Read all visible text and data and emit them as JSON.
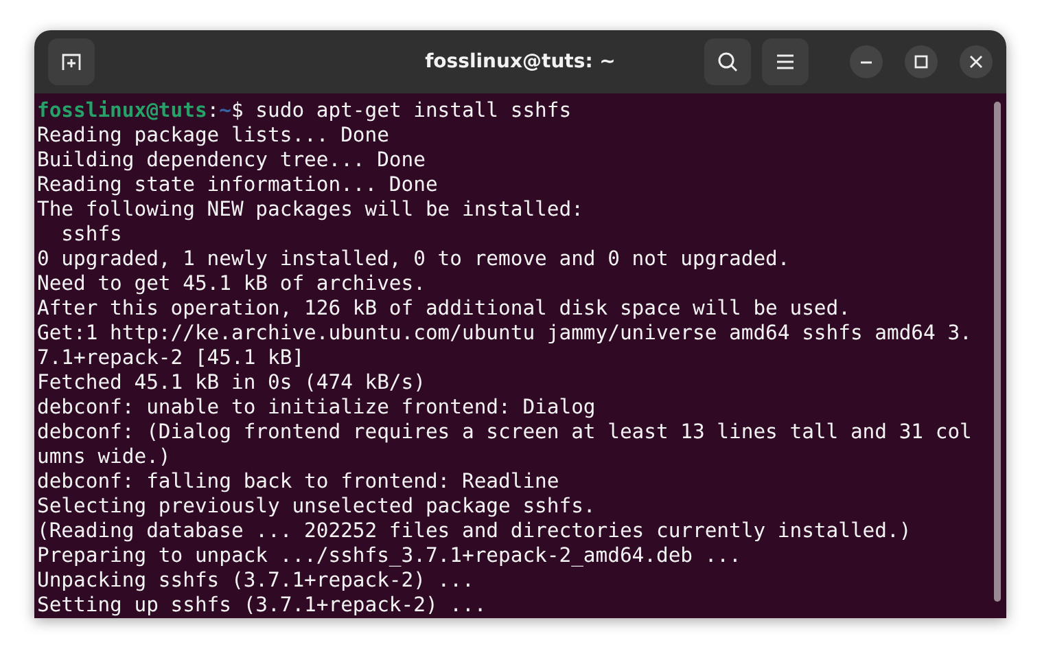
{
  "window": {
    "title": "fosslinux@tuts: ~"
  },
  "prompt": {
    "user": "fosslinux@tuts",
    "separator": ":",
    "path": "~",
    "symbol": "$",
    "command": " sudo apt-get install sshfs"
  },
  "output": [
    "Reading package lists... Done",
    "Building dependency tree... Done",
    "Reading state information... Done",
    "The following NEW packages will be installed:",
    "  sshfs",
    "0 upgraded, 1 newly installed, 0 to remove and 0 not upgraded.",
    "Need to get 45.1 kB of archives.",
    "After this operation, 126 kB of additional disk space will be used.",
    "Get:1 http://ke.archive.ubuntu.com/ubuntu jammy/universe amd64 sshfs amd64 3.",
    "7.1+repack-2 [45.1 kB]",
    "Fetched 45.1 kB in 0s (474 kB/s)",
    "debconf: unable to initialize frontend: Dialog",
    "debconf: (Dialog frontend requires a screen at least 13 lines tall and 31 col",
    "umns wide.)",
    "debconf: falling back to frontend: Readline",
    "Selecting previously unselected package sshfs.",
    "(Reading database ... 202252 files and directories currently installed.)",
    "Preparing to unpack .../sshfs_3.7.1+repack-2_amd64.deb ...",
    "Unpacking sshfs (3.7.1+repack-2) ...",
    "Setting up sshfs (3.7.1+repack-2) ..."
  ]
}
